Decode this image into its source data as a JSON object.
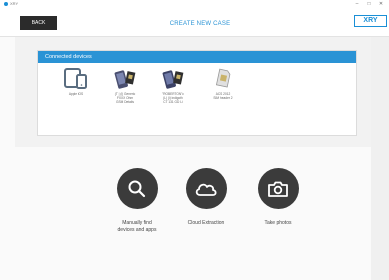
{
  "window": {
    "app_name": "XRY",
    "controls": [
      "–",
      "□",
      "✕"
    ]
  },
  "toolbar": {
    "back_label": "BACK",
    "title": "CREATE NEW CASE",
    "logo_text": "XRY"
  },
  "devices_panel": {
    "title": "Connected devices",
    "devices": [
      {
        "label": "Apple iOS",
        "icon": "apple-ios-devices-icon"
      },
      {
        "label": "(T | (i) Generic\nFXXX Ohm\nGSM Details",
        "icon": "phone-sim-icon"
      },
      {
        "label": "\"ROBERTON\"c\n(L) (i) indigoth\nCT 131 GD Li",
        "icon": "phone-sim-icon"
      },
      {
        "label": "ACS 2012\nSIM header 2",
        "icon": "sim-card-icon"
      }
    ]
  },
  "actions": [
    {
      "label": "Manually find\ndevices and apps",
      "icon": "search-icon"
    },
    {
      "label": "Cloud Extraction",
      "icon": "cloud-icon"
    },
    {
      "label": "Take photos",
      "icon": "camera-icon"
    }
  ],
  "colors": {
    "accent": "#2a93d5",
    "button_dark": "#2b2b2b",
    "circle": "#3b3b3b"
  }
}
